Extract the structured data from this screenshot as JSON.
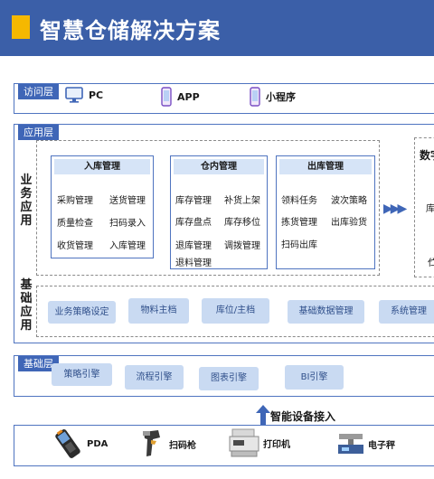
{
  "header": {
    "title": "智慧仓储解决方案"
  },
  "access_layer": {
    "tag": "访问层",
    "items": [
      {
        "icon": "monitor-icon",
        "label": "PC"
      },
      {
        "icon": "phone-icon",
        "label": "APP"
      },
      {
        "icon": "phone-icon",
        "label": "小程序"
      }
    ]
  },
  "app_layer": {
    "tag": "应用层",
    "business_label": "业务应用",
    "base_label": "基础应用",
    "modules": [
      {
        "title": "入库管理",
        "items": [
          "采购管理",
          "送货管理",
          "质量检查",
          "扫码录入",
          "收货管理",
          "入库管理"
        ]
      },
      {
        "title": "仓内管理",
        "items": [
          "库存管理",
          "补货上架",
          "库存盘点",
          "库存移位",
          "退库管理",
          "调拨管理",
          "退料管理"
        ]
      },
      {
        "title": "出库管理",
        "items": [
          "领料任务",
          "波次策略",
          "拣货管理",
          "出库验货",
          "扫码出库"
        ]
      }
    ],
    "arrow_glyphs": "▶▶▶",
    "partial_title": "数字",
    "partial_fragments": [
      "库",
      "伫"
    ],
    "base_chips": [
      "业务策略设定",
      "物料主档",
      "库位/主档",
      "基础数据管理",
      "系统管理"
    ]
  },
  "base_layer": {
    "tag": "基础层",
    "engines": [
      "策略引擎",
      "流程引擎",
      "图表引擎",
      "BI引擎"
    ]
  },
  "device_access": {
    "label": "智能设备接入"
  },
  "devices": [
    {
      "icon": "pda-icon",
      "label": "PDA"
    },
    {
      "icon": "scanner-icon",
      "label": "扫码枪"
    },
    {
      "icon": "printer-icon",
      "label": "打印机"
    },
    {
      "icon": "scale-icon",
      "label": "电子秤"
    }
  ],
  "colors": {
    "header_bg": "#3b5fa8",
    "accent": "#f5b800",
    "tag_bg": "#3f66b7",
    "border": "#4f74c0",
    "chip_bg": "#c9daf2"
  }
}
